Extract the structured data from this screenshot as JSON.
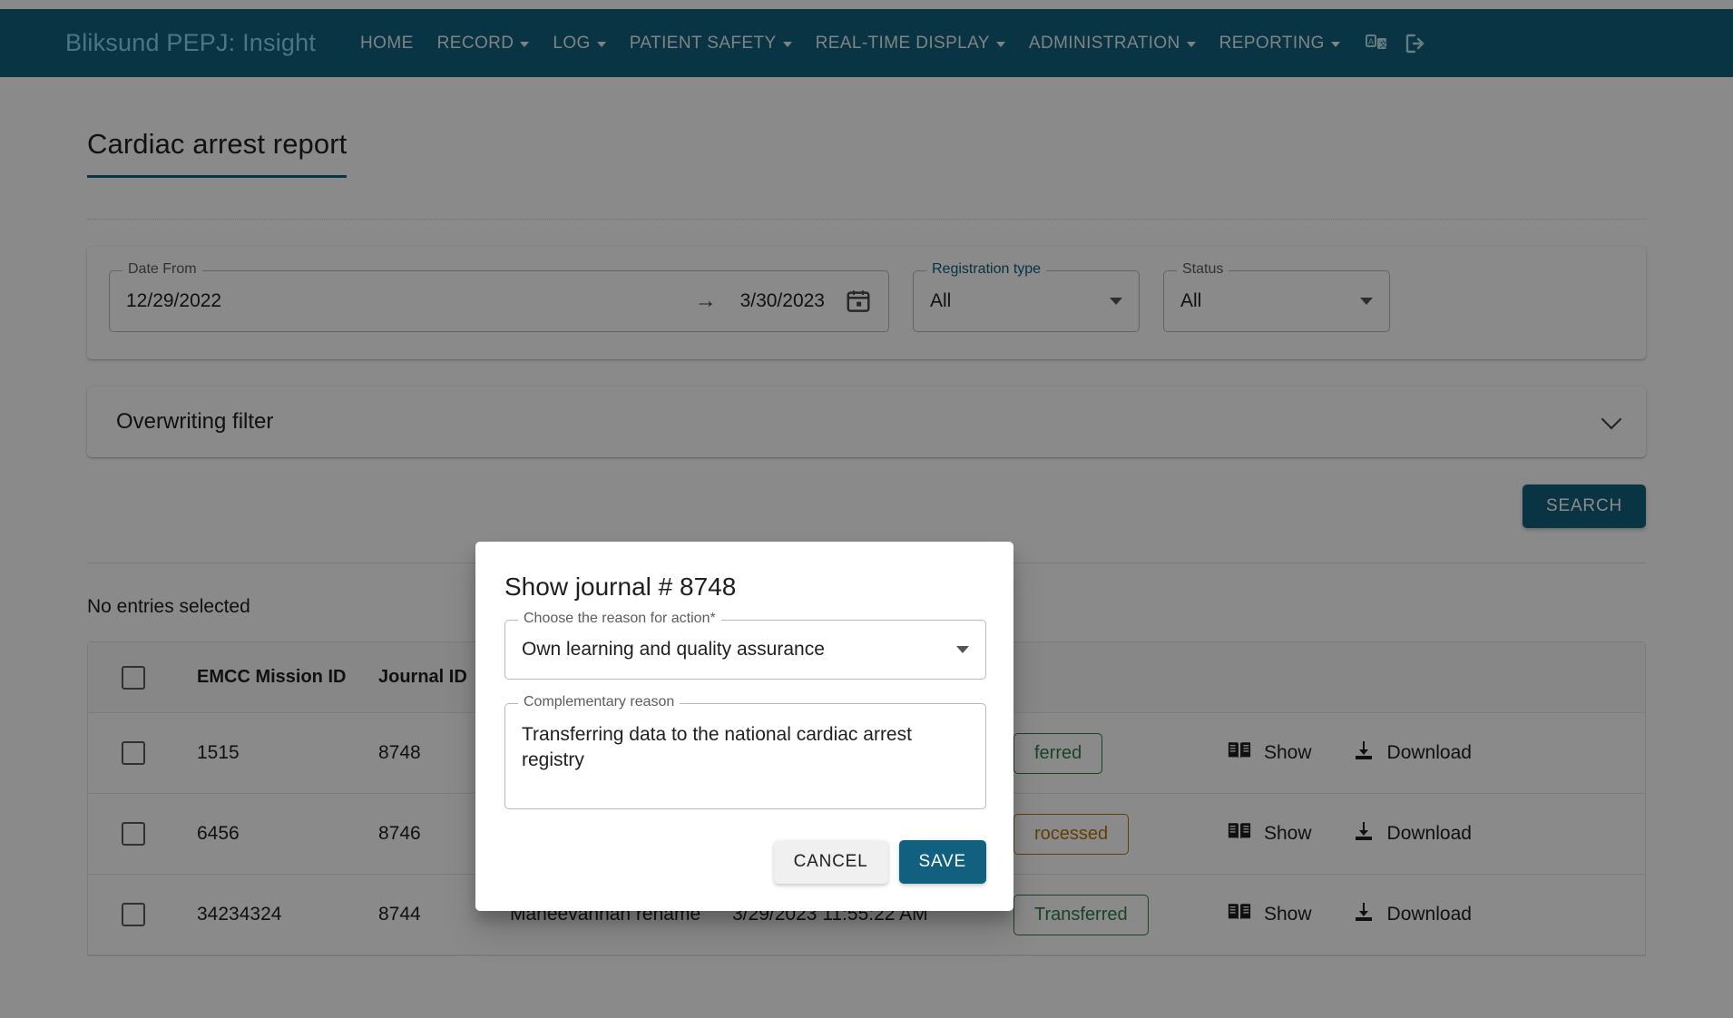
{
  "navbar": {
    "brand": "Bliksund PEPJ: Insight",
    "items": [
      {
        "label": "HOME",
        "caret": false
      },
      {
        "label": "RECORD",
        "caret": true
      },
      {
        "label": "LOG",
        "caret": true
      },
      {
        "label": "PATIENT SAFETY",
        "caret": true
      },
      {
        "label": "REAL-TIME DISPLAY",
        "caret": true
      },
      {
        "label": "ADMINISTRATION",
        "caret": true
      },
      {
        "label": "REPORTING",
        "caret": true
      }
    ],
    "icons": [
      {
        "name": "translate-icon"
      },
      {
        "name": "logout-icon"
      }
    ],
    "background": "#11607f",
    "brand_color": "#8fd6ef"
  },
  "page": {
    "title": "Cardiac arrest report"
  },
  "filters": {
    "date_range": {
      "legend": "Date From",
      "from": "12/29/2022",
      "separator": "→",
      "to": "3/30/2023"
    },
    "registration_type": {
      "legend": "Registration type",
      "value": "All"
    },
    "status": {
      "legend": "Status",
      "value": "All"
    }
  },
  "overwriting_filter": {
    "title": "Overwriting filter"
  },
  "search_button": {
    "label": "SEARCH"
  },
  "selection": {
    "text": "No entries selected"
  },
  "table": {
    "headers": {
      "check": "",
      "emcc": "EMCC Mission ID",
      "journal": "Journal ID",
      "name": "",
      "time": "",
      "status": "",
      "actions": ""
    },
    "rows": [
      {
        "emcc": "1515",
        "journal": "8748",
        "name": "",
        "time": "",
        "status": "ferred",
        "status_kind": "green",
        "show": "Show",
        "download": "Download"
      },
      {
        "emcc": "6456",
        "journal": "8746",
        "name": "",
        "time": "",
        "status": "rocessed",
        "status_kind": "orange",
        "show": "Show",
        "download": "Download"
      },
      {
        "emcc": "34234324",
        "journal": "8744",
        "name": "Maneevannan rename",
        "time": "3/29/2023 11:55:22 AM",
        "status": "Transferred",
        "status_kind": "green",
        "show": "Show",
        "download": "Download"
      }
    ]
  },
  "modal": {
    "title": "Show journal # 8748",
    "reason": {
      "legend": "Choose the reason for action*",
      "value": "Own learning and quality assurance"
    },
    "complementary": {
      "legend": "Complementary reason",
      "value": "Transferring data to the national cardiac arrest registry"
    },
    "cancel_label": "CANCEL",
    "save_label": "SAVE"
  },
  "colors": {
    "accent": "#11607f",
    "badge_green": "#2e7d46",
    "badge_orange": "#b3730d"
  }
}
